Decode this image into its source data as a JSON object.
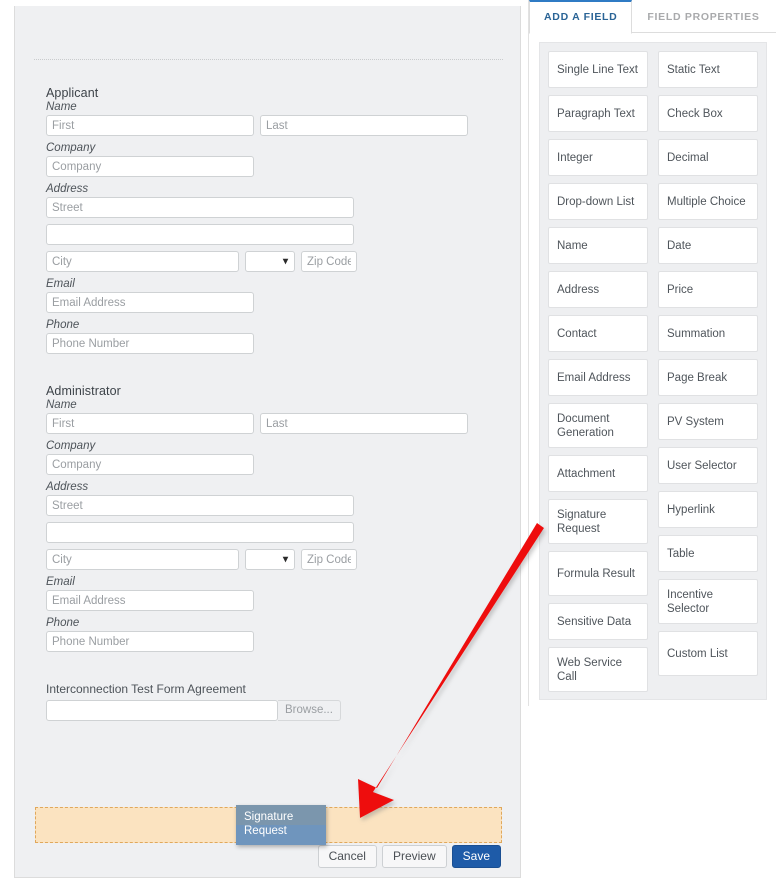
{
  "form": {
    "sections": [
      {
        "title": "Applicant",
        "labels": {
          "name": "Name",
          "company": "Company",
          "address": "Address",
          "email": "Email",
          "phone": "Phone"
        },
        "placeholders": {
          "first": "First",
          "last": "Last",
          "company": "Company",
          "street": "Street",
          "street2": "",
          "city": "City",
          "state": "",
          "zip": "Zip Code",
          "email": "Email Address",
          "phone": "Phone Number"
        }
      },
      {
        "title": "Administrator",
        "labels": {
          "name": "Name",
          "company": "Company",
          "address": "Address",
          "email": "Email",
          "phone": "Phone"
        },
        "placeholders": {
          "first": "First",
          "last": "Last",
          "company": "Company",
          "street": "Street",
          "street2": "",
          "city": "City",
          "state": "",
          "zip": "Zip Code",
          "email": "Email Address",
          "phone": "Phone Number"
        }
      }
    ],
    "attachment": {
      "label": "Interconnection Test Form Agreement",
      "value": "",
      "browse_label": "Browse..."
    },
    "actions": {
      "cancel": "Cancel",
      "preview": "Preview",
      "save": "Save"
    }
  },
  "drag": {
    "ghost_label": "Signature Request",
    "placeholder_color": "#fbe3c0",
    "placeholder_border_color": "#e0a85c",
    "ghost_color_top": "#7b96ad",
    "ghost_color_bottom": "#6f95bd"
  },
  "palette": {
    "tabs": [
      {
        "label": "ADD A FIELD",
        "active": true
      },
      {
        "label": "FIELD PROPERTIES",
        "active": false
      }
    ],
    "active_tab_color": "#2f7bc4",
    "left_column": [
      "Single Line Text",
      "Paragraph Text",
      "Integer",
      "Drop-down List",
      "Name",
      "Address",
      "Contact",
      "Email Address",
      "Document Generation",
      "Attachment",
      "Signature Request",
      "Formula Result",
      "Sensitive Data",
      "Web Service Call"
    ],
    "right_column": [
      "Static Text",
      "Check Box",
      "Decimal",
      "Multiple Choice",
      "Date",
      "Price",
      "Summation",
      "Page Break",
      "PV System",
      "User Selector",
      "Hyperlink",
      "Table",
      "Incentive Selector",
      "Custom List"
    ]
  },
  "annotation": {
    "arrow_color": "#ee1111",
    "arrow_name": "drag-direction-arrow"
  }
}
